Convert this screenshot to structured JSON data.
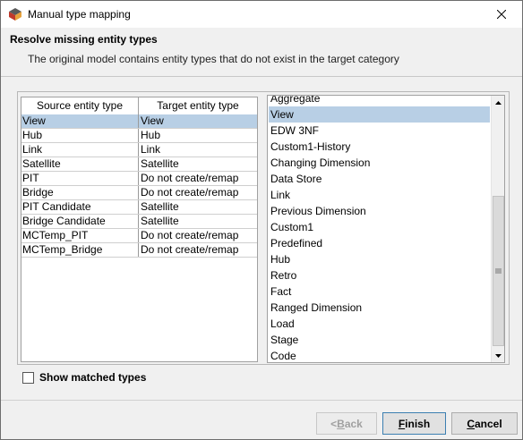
{
  "window": {
    "title": "Manual type mapping",
    "icon": "app-logo-icon"
  },
  "header": {
    "title": "Resolve missing entity types",
    "description": "The original model contains entity types that do not exist in the target category"
  },
  "mapping_table": {
    "columns": [
      "Source entity type",
      "Target entity type"
    ],
    "rows": [
      {
        "source": "View",
        "target": "View",
        "selected": true
      },
      {
        "source": "Hub",
        "target": "Hub",
        "selected": false
      },
      {
        "source": "Link",
        "target": "Link",
        "selected": false
      },
      {
        "source": "Satellite",
        "target": "Satellite",
        "selected": false
      },
      {
        "source": "PIT",
        "target": "Do not create/remap",
        "selected": false
      },
      {
        "source": "Bridge",
        "target": "Do not create/remap",
        "selected": false
      },
      {
        "source": "PIT Candidate",
        "target": "Satellite",
        "selected": false
      },
      {
        "source": "Bridge Candidate",
        "target": "Satellite",
        "selected": false
      },
      {
        "source": "MCTemp_PIT",
        "target": "Do not create/remap",
        "selected": false
      },
      {
        "source": "MCTemp_Bridge",
        "target": "Do not create/remap",
        "selected": false
      }
    ]
  },
  "target_list": {
    "items": [
      "Aggregate",
      "View",
      "EDW 3NF",
      "Custom1-History",
      "Changing Dimension",
      "Data Store",
      "Link",
      "Previous Dimension",
      "Custom1",
      "Predefined",
      "Hub",
      "Retro",
      "Fact",
      "Ranged Dimension",
      "Load",
      "Stage",
      "Code"
    ],
    "selected_index": 1
  },
  "show_matched": {
    "label": "Show matched types",
    "checked": false
  },
  "buttons": {
    "back": {
      "prefix": "< ",
      "mnemonic": "B",
      "rest": "ack",
      "enabled": false
    },
    "finish": {
      "mnemonic": "F",
      "rest": "inish",
      "enabled": true
    },
    "cancel": {
      "mnemonic": "C",
      "rest": "ancel",
      "enabled": true
    }
  },
  "colors": {
    "selection": "#b8cfe5",
    "focus_border": "#3c7fb1"
  }
}
